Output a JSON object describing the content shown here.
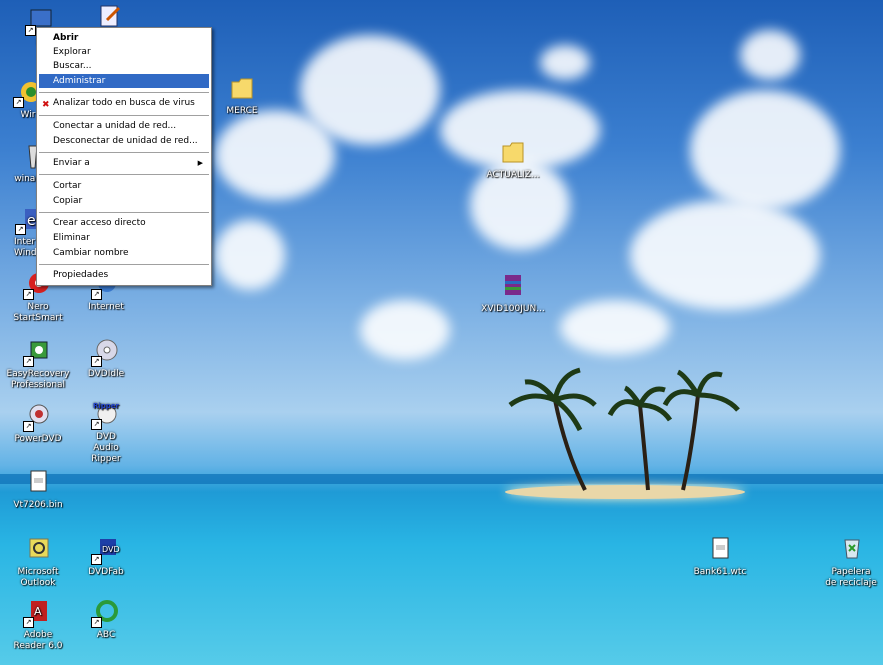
{
  "context_menu": {
    "items": [
      {
        "label": "Abrir"
      },
      {
        "label": "Explorar"
      },
      {
        "label": "Buscar..."
      },
      {
        "label": "Administrar"
      },
      {
        "label": "Analizar todo en busca de virus"
      },
      {
        "label": "Conectar a unidad de red..."
      },
      {
        "label": "Desconectar de unidad de red..."
      },
      {
        "label": "Enviar a"
      },
      {
        "label": "Cortar"
      },
      {
        "label": "Copiar"
      },
      {
        "label": "Crear acceso directo"
      },
      {
        "label": "Eliminar"
      },
      {
        "label": "Cambiar nombre"
      },
      {
        "label": "Propiedades"
      }
    ],
    "selected": "Administrar"
  },
  "desktop_icons": {
    "partial_top": "M",
    "partial_win": "Wir",
    "partial_winamp": "winamp",
    "partial_internet_win": "Inter Wind",
    "merce": "MERCE",
    "actualiz": "ACTUALIZ...",
    "xvid": "XVID100JUN...",
    "nero": "Nero StartSmart",
    "internet": "Internet",
    "easyrecovery": "EasyRecovery Professional",
    "dvdidle": "DVDIdle",
    "powerdvd": "PowerDVD",
    "dvd_audio_ripper": "DVD Audio Ripper",
    "vt7206": "Vt7206.bin",
    "outlook": "Microsoft Outlook",
    "dvdfab": "DVDFab",
    "bank": "Bank61.wtc",
    "recycle": "Papelera de reciclaje",
    "adobe": "Adobe Reader 6.0",
    "abc": "ABC"
  },
  "icon_glyphs": {
    "ripper": "Ripper"
  },
  "colors": {
    "menu_highlight": "#316ac5",
    "sky_top": "#1e5fb7",
    "sea": "#29b5e4"
  }
}
